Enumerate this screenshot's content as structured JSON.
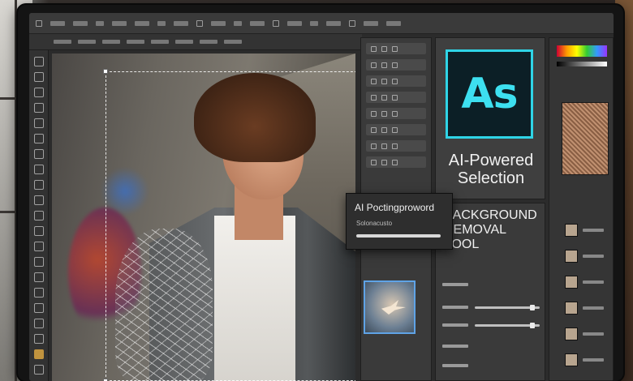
{
  "app": {
    "logo_text": "As",
    "brand_caption": [
      "AI-Powered",
      "Selection"
    ]
  },
  "dialog": {
    "title": "AI Poctingproword",
    "subtitle": "Solonacusto"
  },
  "feature_panel": {
    "title": [
      "Background",
      "Removal",
      "Tool"
    ]
  },
  "colors": {
    "accent": "#3de0f0",
    "logo_bg": "#0c1f26",
    "selection": "#ffffff",
    "thumb_border": "#5fa3e6"
  },
  "icons": [
    "crop-icon",
    "brush-icon",
    "lasso-icon",
    "eraser-icon",
    "text-icon",
    "zoom-icon",
    "hand-icon"
  ]
}
